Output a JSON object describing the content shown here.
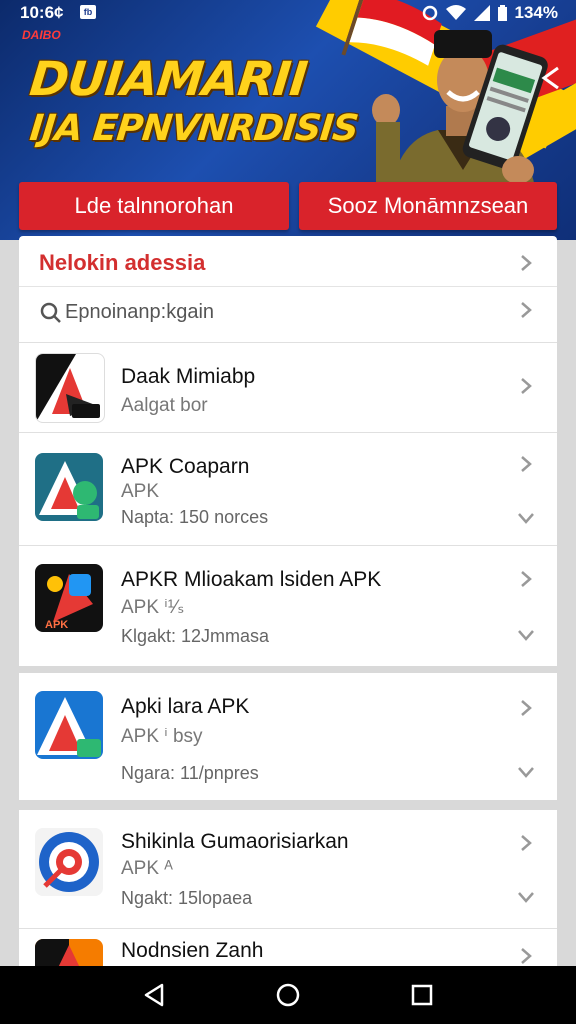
{
  "status_bar": {
    "time": "10:6¢",
    "notification_badge": "fb",
    "battery": "134%",
    "icons": [
      "data-saver-icon",
      "wifi-icon",
      "signal-icon",
      "battery-icon"
    ]
  },
  "banner": {
    "tag": "DAIBO",
    "headline_line1": "DUIAMARII",
    "headline_line2": "IJA EPNVNRDISIS",
    "colors": {
      "background": "#1d4fb0",
      "headline": "#ffd21c",
      "accent_red": "#d9232b"
    }
  },
  "tabs": [
    {
      "label": "Lde talnnorohan"
    },
    {
      "label": "Sooz Monāmnzsean"
    }
  ],
  "section": {
    "title": "Nelokin adessia",
    "search_placeholder": "Epnoinanp:kgain"
  },
  "apps": [
    {
      "name": "Daak Mimiabp",
      "subtitle": "Aalgat bor",
      "meta": "",
      "icon": "app-a-black-icon"
    },
    {
      "name": "APK Coaparn",
      "subtitle": "APK",
      "meta": "Napta: 150 norces",
      "icon": "app-a-teal-icon"
    },
    {
      "name": "APKR Mlioakam lsiden APK",
      "subtitle": "APK ⁱ¹⁄ₛ",
      "meta": "Klgakt: 12Jmmasa",
      "icon": "app-fire-icon"
    },
    {
      "name": "Apki lara APK",
      "subtitle": "APK ⁱ bsy",
      "meta": "Ngara: 11/pnpres",
      "icon": "app-a-blue-icon"
    },
    {
      "name": "Shikinla Gumaorisiarkan",
      "subtitle": "APK ᴬ",
      "meta": "Ngakt: 15lopaea",
      "icon": "app-target-icon"
    },
    {
      "name": "Nodnsien Zanh",
      "subtitle": "",
      "meta": "",
      "icon": "app-orange-icon"
    }
  ],
  "nav": {
    "icons": [
      "back-icon",
      "home-icon",
      "recents-icon"
    ]
  }
}
